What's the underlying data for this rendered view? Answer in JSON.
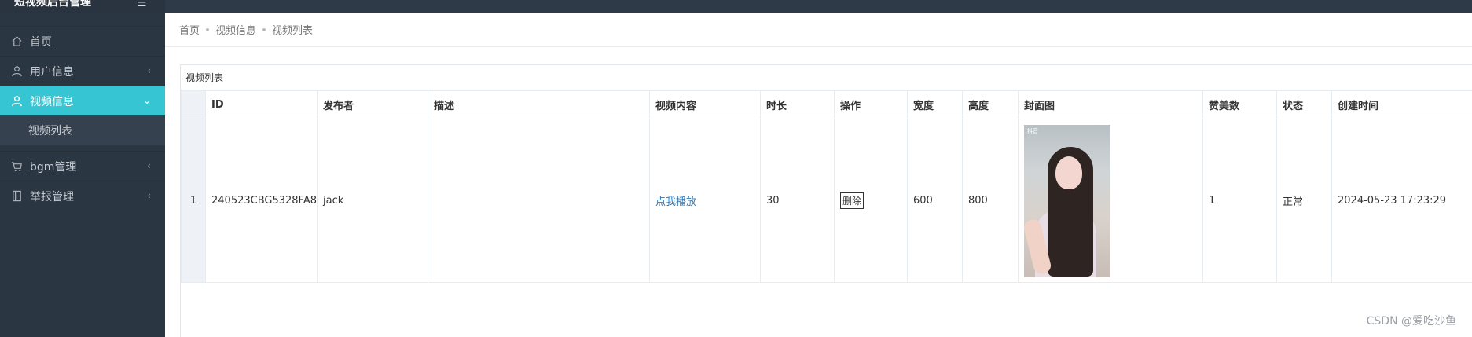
{
  "app": {
    "title": "短视频后台管理"
  },
  "sidebar": {
    "items": [
      {
        "label": "首页",
        "icon": "home-icon"
      },
      {
        "label": "用户信息",
        "icon": "user-icon"
      },
      {
        "label": "视频信息",
        "icon": "user-icon",
        "active": true
      },
      {
        "label": "视频列表",
        "sub": true
      },
      {
        "label": "bgm管理",
        "icon": "cart-icon"
      },
      {
        "label": "举报管理",
        "icon": "book-icon"
      }
    ]
  },
  "breadcrumb": [
    "首页",
    "视频信息",
    "视频列表"
  ],
  "panel": {
    "title": "视频列表"
  },
  "table": {
    "columns": [
      "ID",
      "发布者",
      "描述",
      "视频内容",
      "时长",
      "操作",
      "宽度",
      "高度",
      "封面图",
      "赞美数",
      "状态",
      "创建时间"
    ],
    "rows": [
      {
        "index": "1",
        "id": "240523CBG5328FA8",
        "publisher": "jack",
        "description": "",
        "video_link": "点我播放",
        "duration": "30",
        "action": "删除",
        "width": "600",
        "height": "800",
        "cover_badge": "抖音",
        "likes": "1",
        "status": "正常",
        "created": "2024-05-23 17:23:29"
      }
    ]
  },
  "watermark": "CSDN @爱吃沙鱼",
  "colors": {
    "accent": "#36c6d3",
    "sidebar": "#2b3643",
    "link": "#337ab7"
  }
}
